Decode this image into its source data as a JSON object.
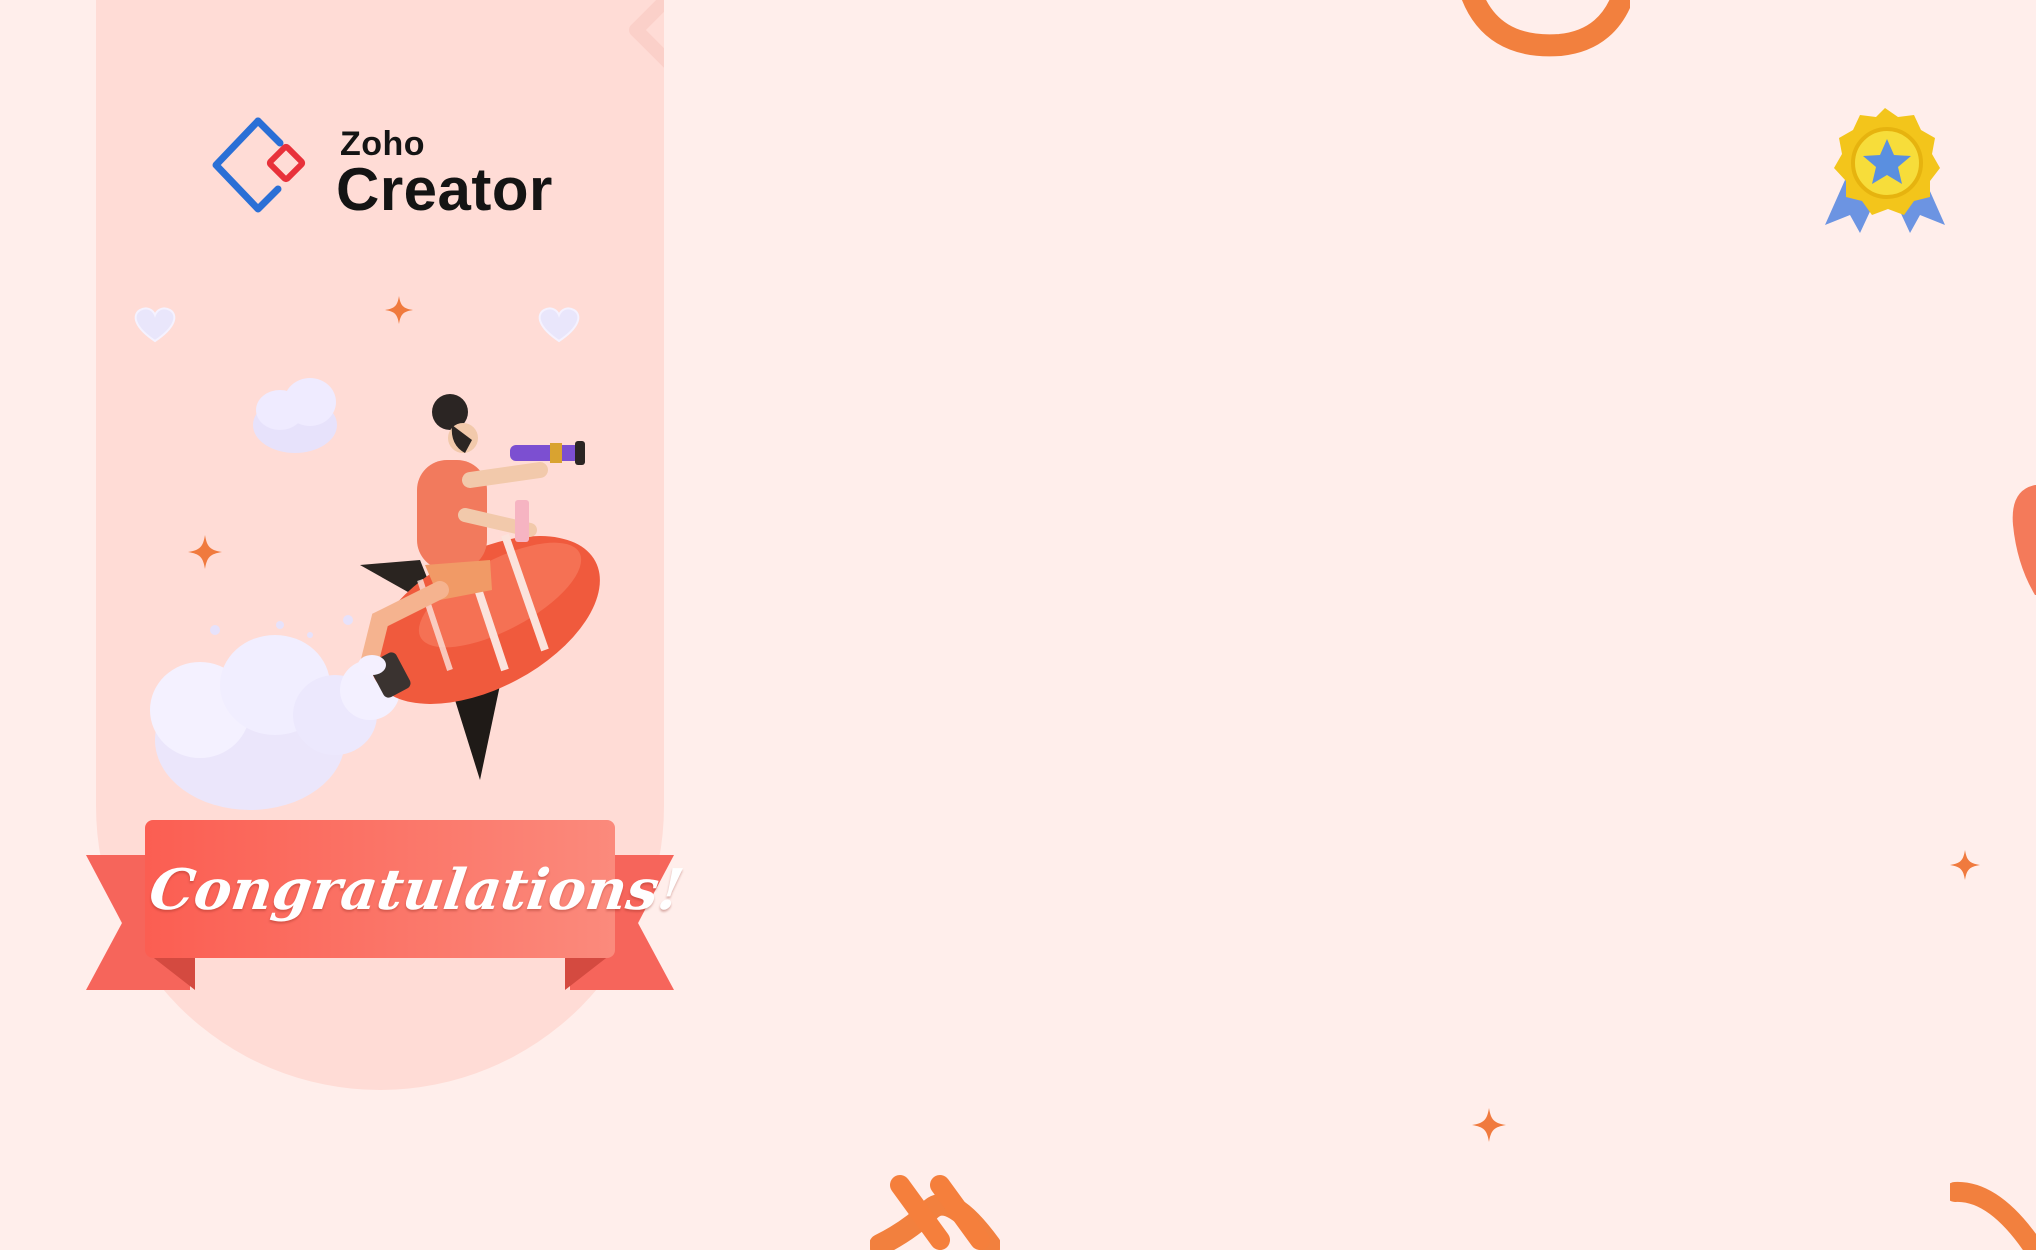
{
  "logo": {
    "brand": "Zoho",
    "product": "Creator"
  },
  "banner": {
    "text": "Congratulations!"
  },
  "colors": {
    "background": "#ffeeeb",
    "panel": "#ffdcd6",
    "ribbon": "#fb6f62",
    "accent_orange": "#f47a3a",
    "logo_blue": "#2a6fd6",
    "logo_red": "#e8313a",
    "medal_gold": "#f3c51b",
    "medal_blue": "#5a8fe0"
  },
  "icons": [
    "zoho-creator-logo-icon",
    "heart-icon",
    "sparkle-star-icon",
    "cloud-icon",
    "rocket-rider-illustration",
    "ribbon-banner",
    "medal-badge-icon",
    "torus-ring-icon",
    "tube-shape-icon",
    "cross-shape-icon"
  ]
}
